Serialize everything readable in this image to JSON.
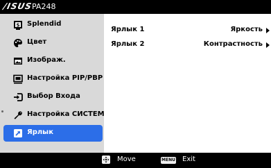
{
  "header": {
    "logo": "/ISUS",
    "model": "PA248"
  },
  "sidebar": {
    "items": [
      {
        "label": "Splendid",
        "icon": "splendid-s-icon"
      },
      {
        "label": "Цвет",
        "icon": "palette-icon"
      },
      {
        "label": "Изображ.",
        "icon": "image-icon"
      },
      {
        "label": "Настройка PIP/PBP",
        "icon": "pip-icon"
      },
      {
        "label": "Выбор Входа",
        "icon": "input-select-icon"
      },
      {
        "label": "Настройка СИСТЕМА",
        "icon": "wrench-icon"
      },
      {
        "label": "Ярлык",
        "icon": "shortcut-icon",
        "active": true
      }
    ]
  },
  "main": {
    "rows": [
      {
        "name": "Ярлык 1",
        "value": "Яркость"
      },
      {
        "name": "Ярлык 2",
        "value": "Контрастность"
      }
    ]
  },
  "footer": {
    "move_label": "Move",
    "menu_key": "MENU",
    "exit_label": "Exit"
  },
  "colors": {
    "accent": "#2c6ee8",
    "sidebar_bg": "#d9d9d9",
    "bar_bg": "#000000"
  }
}
